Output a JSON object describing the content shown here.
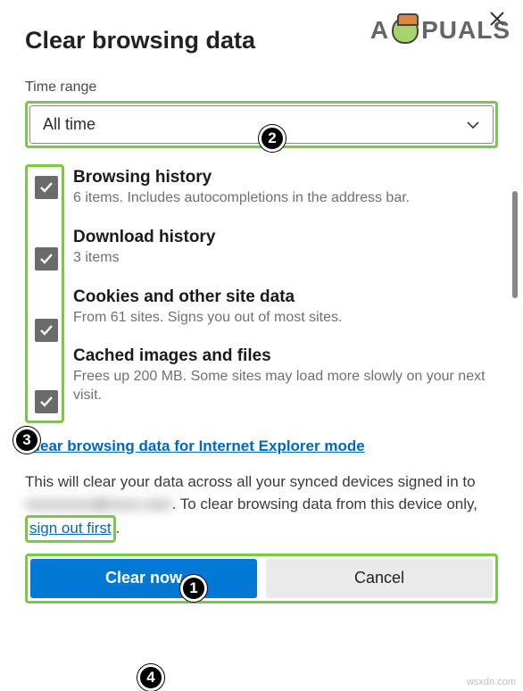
{
  "dialog": {
    "title": "Clear browsing data",
    "time_range_label": "Time range",
    "time_range_value": "All time",
    "ie_link": "Clear browsing data for Internet Explorer mode",
    "info_prefix": "This will clear your data across all your synced devices signed in to ",
    "info_email": "xxxxxxxxx@xxxx.com",
    "info_mid": ". To clear browsing data from this device only, ",
    "signout": "sign out first",
    "info_suffix": ".",
    "clear_label": "Clear now",
    "cancel_label": "Cancel"
  },
  "options": [
    {
      "title": "Browsing history",
      "desc": "6 items. Includes autocompletions in the address bar."
    },
    {
      "title": "Download history",
      "desc": "3 items"
    },
    {
      "title": "Cookies and other site data",
      "desc": "From 61 sites. Signs you out of most sites."
    },
    {
      "title": "Cached images and files",
      "desc": "Frees up 200 MB. Some sites may load more slowly on your next visit."
    }
  ],
  "annotations": {
    "b1": "1",
    "b2": "2",
    "b3": "3",
    "b4": "4"
  },
  "watermark": {
    "brand_left": "A",
    "brand_right": "PUALS",
    "source": "wsxdn.com"
  }
}
